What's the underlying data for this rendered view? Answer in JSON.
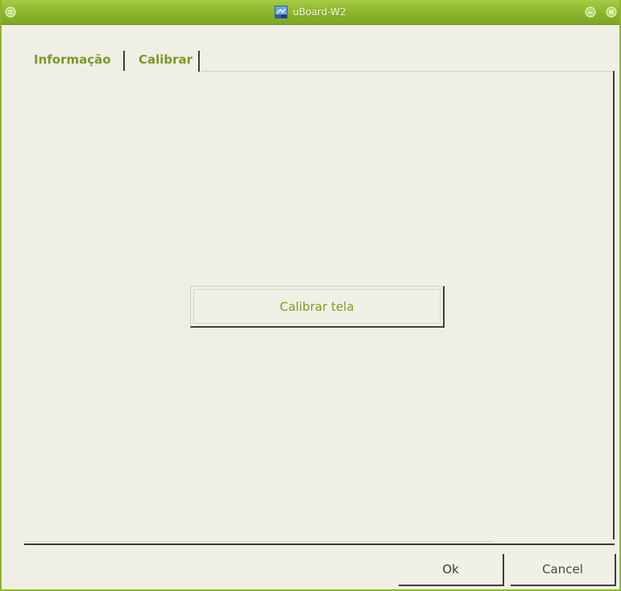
{
  "window": {
    "title": "uBoard-W2",
    "accent_color": "#8ab42a",
    "title_icon": "app-icon",
    "title_buttons": [
      "menu-icon",
      "minimize-icon",
      "close-icon"
    ]
  },
  "tabs": [
    {
      "label": "Informação"
    },
    {
      "label": "Calibrar",
      "active": true
    }
  ],
  "calibrar": {
    "calibrate_label": "Calibrar tela"
  },
  "footer": {
    "ok_label": "Ok",
    "cancel_label": "Cancel"
  }
}
